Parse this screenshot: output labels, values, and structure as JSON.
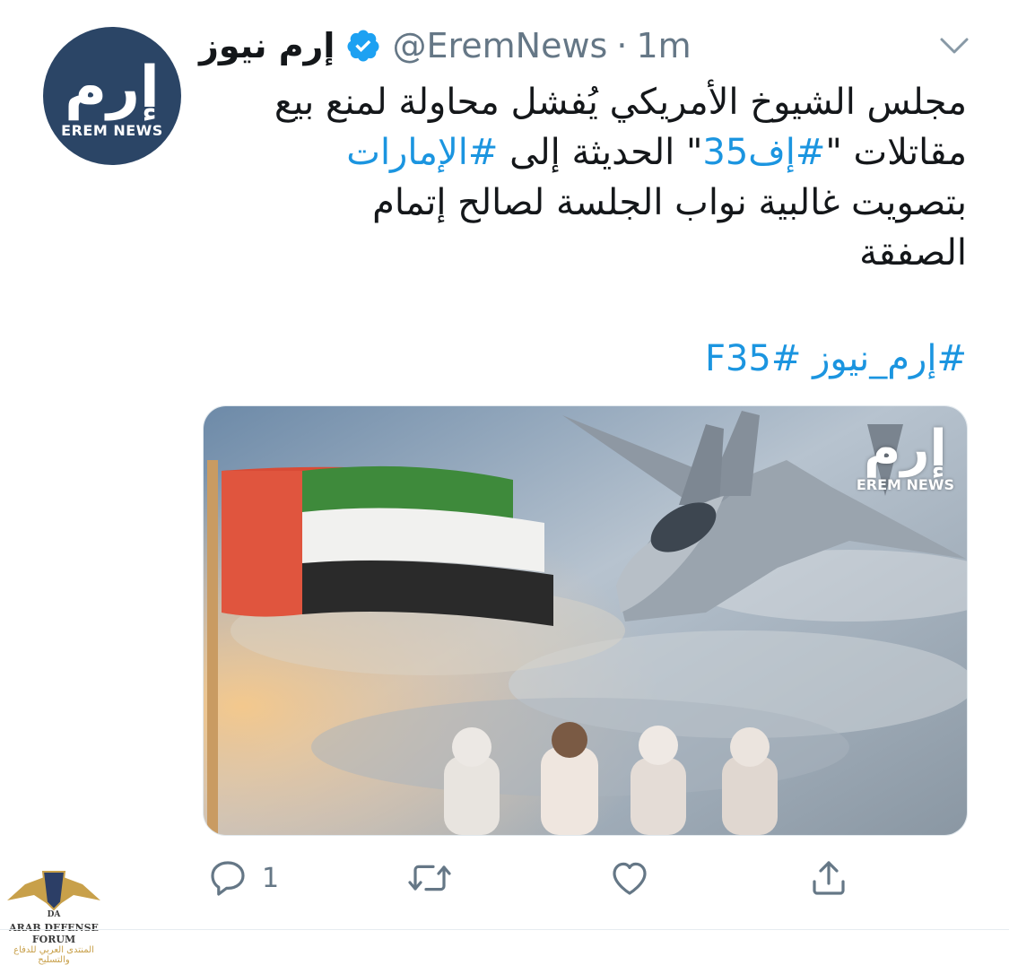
{
  "account": {
    "avatar_logo_text": "إرم",
    "avatar_logo_sub": "EREM NEWS",
    "display_name": "إرم نيوز",
    "handle": "@EremNews",
    "separator": "·",
    "timestamp": "1m"
  },
  "tweet": {
    "line1": "مجلس الشيوخ الأمريكي يُفشل محاولة لمنع بيع",
    "line2_before": "مقاتلات \"",
    "line2_tag1": "#إف35",
    "line2_middle": "\" الحديثة إلى ",
    "line2_tag2": "#الإمارات",
    "line3": "بتصويت غالبية نواب الجلسة لصالح إتمام",
    "line4": "الصفقة",
    "tag3": "#إرم_نيوز",
    "tag4": "#F35"
  },
  "media": {
    "logo_text": "إرم",
    "logo_sub": "EREM NEWS"
  },
  "actions": {
    "reply_count": "1"
  },
  "watermark": {
    "top": "ARAB DEFENSE FORUM",
    "bottom": "المنتدى العربي للدفاع والتسليح"
  },
  "colors": {
    "link": "#1b95e0",
    "muted": "#657786",
    "avatar_bg": "#2b4566"
  }
}
